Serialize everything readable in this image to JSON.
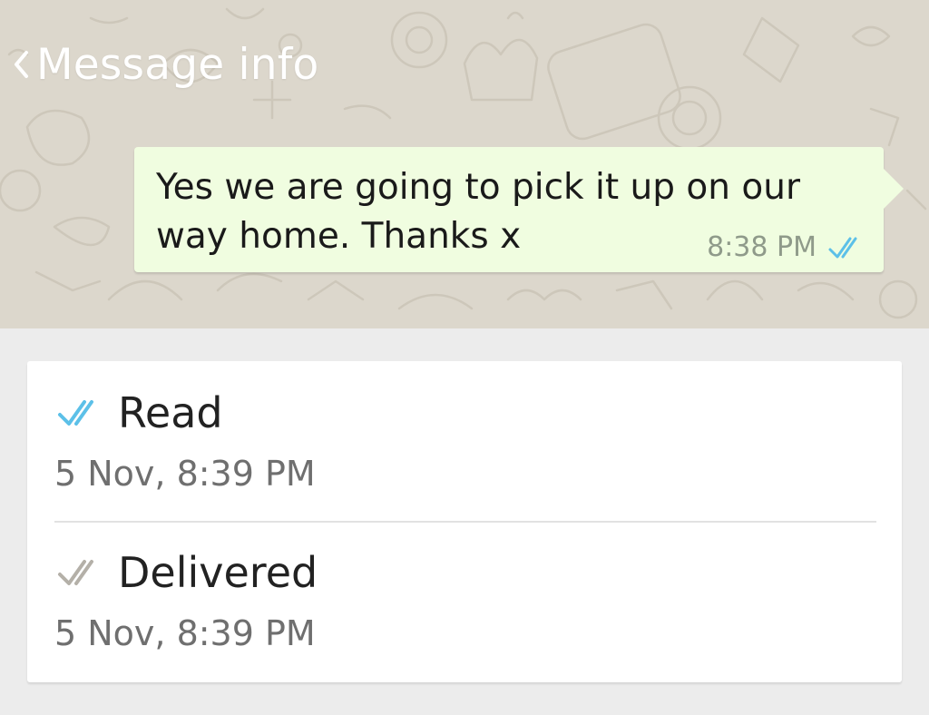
{
  "header": {
    "title": "Message info",
    "back_icon": "chevron-left-icon"
  },
  "message": {
    "text": "Yes we are going to pick it up on our way home. Thanks x",
    "time": "8:38 PM",
    "status_icon": "double-check-icon",
    "bubble_color": "#f0fde0"
  },
  "receipts": {
    "read": {
      "label": "Read",
      "time": "5 Nov, 8:39 PM",
      "icon": "double-check-read-icon",
      "icon_color": "#5cc0e8"
    },
    "delivered": {
      "label": "Delivered",
      "time": "5 Nov, 8:39 PM",
      "icon": "double-check-delivered-icon",
      "icon_color": "#b4b0a8"
    }
  },
  "colors": {
    "wallpaper": "#dcd7cc",
    "page_background": "#ececec",
    "read_tick": "#5cc0e8"
  }
}
